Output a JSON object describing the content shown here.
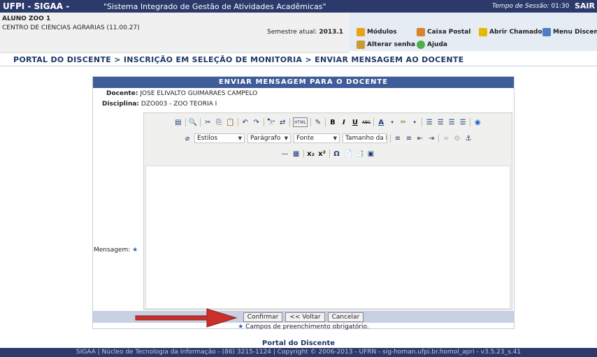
{
  "header": {
    "system_name": "UFPI - SIGAA -",
    "system_description": "\"Sistema Integrado de Gestão de Atividades Acadêmicas\"",
    "session_label": "Tempo de Sessão:",
    "session_time": "01:30",
    "logout_label": "SAIR"
  },
  "user": {
    "name": "ALUNO ZOO 1",
    "center": "CENTRO DE CIENCIAS AGRARIAS (11.00.27)",
    "semester_label": "Semestre atual:",
    "semester_value": "2013.1"
  },
  "menu": {
    "modulos": "Módulos",
    "caixa_postal": "Caixa Postal",
    "abrir_chamado": "Abrir Chamado",
    "menu_discente": "Menu Discente",
    "alterar_senha": "Alterar senha",
    "ajuda": "Ajuda"
  },
  "breadcrumb": "PORTAL DO DISCENTE > INSCRIÇÃO EM SELEÇÃO DE MONITORIA > ENVIAR MENSAGEM AO DOCENTE",
  "form": {
    "title": "ENVIAR MENSAGEM PARA O DOCENTE",
    "docente_label": "Docente:",
    "docente_value": "JOSE ELIVALTO GUIMARAES CAMPELO",
    "disciplina_label": "Disciplina:",
    "disciplina_value": "DZO003 - ZOO TEORIA I",
    "mensagem_label": "Mensagem:",
    "required_mark": "★",
    "editor": {
      "estilos": "Estilos",
      "paragrafo": "Parágrafo",
      "fonte": "Fonte",
      "tamanho": "Tamanho da Fo",
      "bold": "B",
      "italic": "I",
      "underline": "U",
      "strike": "ABC",
      "font_color": "A",
      "html": "HTML",
      "subscript": "x₂",
      "superscript": "x²",
      "omega": "Ω"
    },
    "buttons": {
      "confirmar": "Confirmar",
      "voltar": "<< Voltar",
      "cancelar": "Cancelar"
    },
    "required_note": "Campos de preenchimento obrigatório."
  },
  "footer": {
    "portal_link": "Portal do Discente",
    "copyright": "SIGAA | Núcleo de Tecnologia da Informação - (86) 3215-1124 | Copyright © 2006-2013 - UFRN - sig-homan.ufpi.br.homol_apri - v3.5.23_s.41"
  },
  "colors": {
    "header_bg": "#2b3a6b",
    "panel_head": "#3f5d98",
    "arrow": "#c9302c"
  }
}
